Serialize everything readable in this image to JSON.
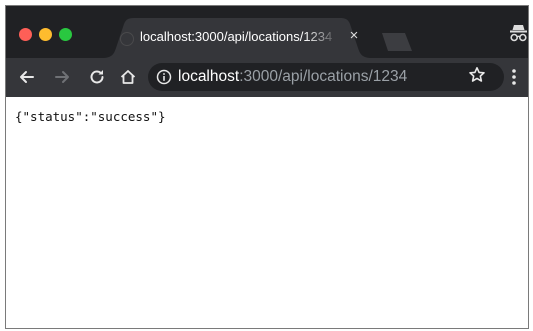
{
  "window": {
    "tab": {
      "title": "localhost:3000/api/locations/1234",
      "close_label": "×"
    },
    "toolbar": {
      "url_host": "localhost",
      "url_path": ":3000/api/locations/1234"
    }
  },
  "content": {
    "body_text": "{\"status\":\"success\"}"
  },
  "icons": {
    "back": "arrow-left",
    "forward": "arrow-right",
    "reload": "refresh",
    "home": "home",
    "info": "info-circle",
    "bookmark": "star",
    "menu": "vertical-ellipsis",
    "incognito": "incognito"
  },
  "colors": {
    "tabstrip": "#202124",
    "toolbar": "#35363a",
    "omnibox": "#202124",
    "traffic_red": "#fe5f57",
    "traffic_yellow": "#febc2e",
    "traffic_green": "#29c840"
  }
}
